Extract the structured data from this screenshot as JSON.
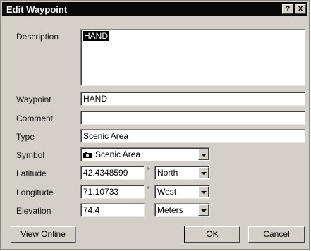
{
  "window": {
    "title": "Edit Waypoint",
    "help_button": "?",
    "close_button": "X"
  },
  "fields": {
    "description": {
      "label": "Description",
      "value": "HAND"
    },
    "waypoint": {
      "label": "Waypoint",
      "value": "HAND"
    },
    "comment": {
      "label": "Comment",
      "value": ""
    },
    "type": {
      "label": "Type",
      "value": "Scenic Area"
    },
    "symbol": {
      "label": "Symbol",
      "value": "Scenic Area",
      "icon": "camera-icon"
    },
    "latitude": {
      "label": "Latitude",
      "value": "42.4348599",
      "unit_symbol": "°",
      "hemisphere": "North"
    },
    "longitude": {
      "label": "Longitude",
      "value": "71.10733",
      "unit_symbol": "°",
      "hemisphere": "West"
    },
    "elevation": {
      "label": "Elevation",
      "value": "74.4",
      "units": "Meters"
    }
  },
  "buttons": {
    "view_online": "View Online",
    "ok": "OK",
    "cancel": "Cancel"
  }
}
